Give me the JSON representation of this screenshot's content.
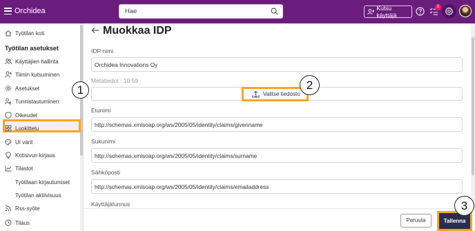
{
  "app": {
    "brand": "Orchidea"
  },
  "search": {
    "placeholder": "Hae"
  },
  "topbar": {
    "invite_label": "Kutsu käyttäjä",
    "notification_count": "1"
  },
  "sidebar": {
    "items": [
      {
        "label": "Työtilan koti",
        "icon": "home-icon"
      },
      {
        "label": "Työtilan asetukset",
        "heading": true
      },
      {
        "label": "Käyttäjien hallinta",
        "icon": "users-icon"
      },
      {
        "label": "Tiimin kutsuminen",
        "icon": "add-user-icon"
      },
      {
        "label": "Asetukset",
        "icon": "gear-icon"
      },
      {
        "label": "Tunnistautuminen",
        "icon": "user-key-icon",
        "active": true
      },
      {
        "label": "Oikeudet",
        "icon": "shield-icon"
      },
      {
        "label": "Luokittelu",
        "icon": "category-icon"
      },
      {
        "label": "UI värit",
        "icon": "palette-icon"
      },
      {
        "label": "Kotisivun kirjaus",
        "icon": "bulb-icon"
      },
      {
        "label": "Tilastot",
        "icon": "chart-icon"
      },
      {
        "label": "Työtilaan kirjautumiset",
        "sub": true
      },
      {
        "label": "Työtilan aktiivisuus",
        "sub": true
      },
      {
        "label": "Rss-syöte",
        "icon": "rss-icon"
      },
      {
        "label": "Tilaus",
        "icon": "clock-icon"
      }
    ]
  },
  "page": {
    "title": "Muokkaa IDP",
    "fields": [
      {
        "label": "IDP nimi",
        "value": "Orchidea Innovations Oy"
      },
      {
        "label": "Etunimi",
        "value": "http://schemas.xmlsoap.org/ws/2005/05/identity/claims/givenname"
      },
      {
        "label": "Sukunimi",
        "value": "http://schemas.xmlsoap.org/ws/2005/05/identity/claims/surname"
      },
      {
        "label": "Sähköposti",
        "value": "http://schemas.xmlsoap.org/ws/2005/05/identity/claims/emailaddress"
      },
      {
        "label": "Käyttäjätunnus",
        "value": ""
      }
    ],
    "metadata_label": "Metatiedot : 10:59",
    "upload_label": "Valitse tiedosto"
  },
  "footer": {
    "cancel_label": "Peruuta",
    "save_label": "Tallenna"
  },
  "markers": [
    "1",
    "2",
    "3"
  ],
  "colors": {
    "topbar": "#6b1d7e",
    "highlight": "#f6a623",
    "save_button": "#2a2e4e"
  }
}
